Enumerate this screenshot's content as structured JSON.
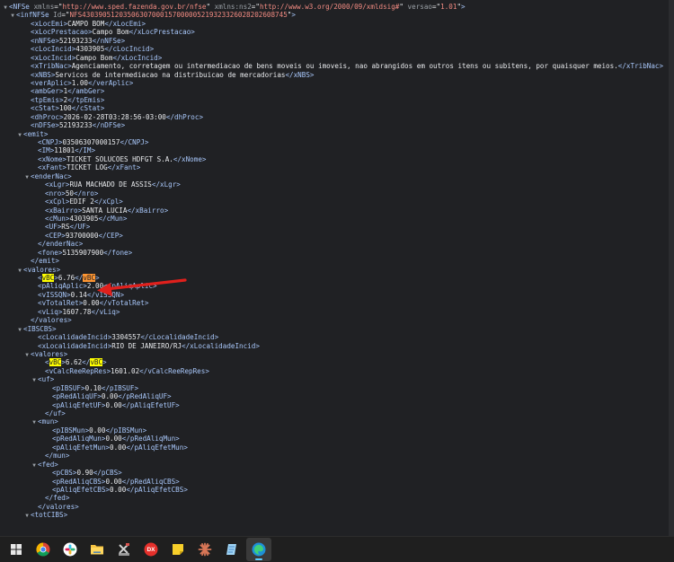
{
  "colors": {
    "tag": "#a8c7fa",
    "attr_name": "#9aa0a6",
    "attr_value": "#f28b82",
    "text": "#e8eaed",
    "highlight": "#ffff00",
    "highlight_current": "#ff9632",
    "annotation_arrow": "#e0201c"
  },
  "xml_lines": [
    {
      "indent": 0,
      "arrow": "down",
      "parts": [
        {
          "c": "tg",
          "t": "<NFSe "
        },
        {
          "c": "an",
          "t": "xmlns"
        },
        {
          "c": "tx",
          "t": "=\""
        },
        {
          "c": "av",
          "t": "http://www.sped.fazenda.gov.br/nfse"
        },
        {
          "c": "tx",
          "t": "\" "
        },
        {
          "c": "an",
          "t": "xmlns:ns2"
        },
        {
          "c": "tx",
          "t": "=\""
        },
        {
          "c": "av",
          "t": "http://www.w3.org/2000/09/xmldsig#"
        },
        {
          "c": "tx",
          "t": "\" "
        },
        {
          "c": "an",
          "t": "versao"
        },
        {
          "c": "tx",
          "t": "=\""
        },
        {
          "c": "av",
          "t": "1.01"
        },
        {
          "c": "tx",
          "t": "\""
        },
        {
          "c": "tg",
          "t": ">"
        }
      ]
    },
    {
      "indent": 1,
      "arrow": "down",
      "parts": [
        {
          "c": "tg",
          "t": "<infNFSe "
        },
        {
          "c": "an",
          "t": "Id"
        },
        {
          "c": "tx",
          "t": "=\""
        },
        {
          "c": "av",
          "t": "NFS43039051203506307000157000005219323326028202608745"
        },
        {
          "c": "tx",
          "t": "\""
        },
        {
          "c": "tg",
          "t": ">"
        }
      ]
    },
    {
      "indent": 3,
      "parts": [
        {
          "c": "tg",
          "t": "<xLocEmi>"
        },
        {
          "c": "tx",
          "t": "CAMPO BOM"
        },
        {
          "c": "tg",
          "t": "</xLocEmi>"
        }
      ]
    },
    {
      "indent": 3,
      "parts": [
        {
          "c": "tg",
          "t": "<xLocPrestacao>"
        },
        {
          "c": "tx",
          "t": "Campo Bom"
        },
        {
          "c": "tg",
          "t": "</xLocPrestacao>"
        }
      ]
    },
    {
      "indent": 3,
      "parts": [
        {
          "c": "tg",
          "t": "<nNFSe>"
        },
        {
          "c": "tx",
          "t": "52193233"
        },
        {
          "c": "tg",
          "t": "</nNFSe>"
        }
      ]
    },
    {
      "indent": 3,
      "parts": [
        {
          "c": "tg",
          "t": "<cLocIncid>"
        },
        {
          "c": "tx",
          "t": "4303905"
        },
        {
          "c": "tg",
          "t": "</cLocIncid>"
        }
      ]
    },
    {
      "indent": 3,
      "parts": [
        {
          "c": "tg",
          "t": "<xLocIncid>"
        },
        {
          "c": "tx",
          "t": "Campo Bom"
        },
        {
          "c": "tg",
          "t": "</xLocIncid>"
        }
      ]
    },
    {
      "indent": 3,
      "parts": [
        {
          "c": "tg",
          "t": "<xTribNac>"
        },
        {
          "c": "tx",
          "t": "Agenciamento, corretagem ou intermediacao de bens moveis ou imoveis, nao abrangidos em outros itens ou subitens, por quaisquer meios."
        },
        {
          "c": "tg",
          "t": "</xTribNac>"
        }
      ]
    },
    {
      "indent": 3,
      "parts": [
        {
          "c": "tg",
          "t": "<xNBS>"
        },
        {
          "c": "tx",
          "t": "Servicos de intermediacao na distribuicao de mercadorias"
        },
        {
          "c": "tg",
          "t": "</xNBS>"
        }
      ]
    },
    {
      "indent": 3,
      "parts": [
        {
          "c": "tg",
          "t": "<verAplic>"
        },
        {
          "c": "tx",
          "t": "1.00"
        },
        {
          "c": "tg",
          "t": "</verAplic>"
        }
      ]
    },
    {
      "indent": 3,
      "parts": [
        {
          "c": "tg",
          "t": "<ambGer>"
        },
        {
          "c": "tx",
          "t": "1"
        },
        {
          "c": "tg",
          "t": "</ambGer>"
        }
      ]
    },
    {
      "indent": 3,
      "parts": [
        {
          "c": "tg",
          "t": "<tpEmis>"
        },
        {
          "c": "tx",
          "t": "2"
        },
        {
          "c": "tg",
          "t": "</tpEmis>"
        }
      ]
    },
    {
      "indent": 3,
      "parts": [
        {
          "c": "tg",
          "t": "<cStat>"
        },
        {
          "c": "tx",
          "t": "100"
        },
        {
          "c": "tg",
          "t": "</cStat>"
        }
      ]
    },
    {
      "indent": 3,
      "parts": [
        {
          "c": "tg",
          "t": "<dhProc>"
        },
        {
          "c": "tx",
          "t": "2026-02-28T03:28:56-03:00"
        },
        {
          "c": "tg",
          "t": "</dhProc>"
        }
      ]
    },
    {
      "indent": 3,
      "parts": [
        {
          "c": "tg",
          "t": "<nDFSe>"
        },
        {
          "c": "tx",
          "t": "52193233"
        },
        {
          "c": "tg",
          "t": "</nDFSe>"
        }
      ]
    },
    {
      "indent": 2,
      "arrow": "down",
      "parts": [
        {
          "c": "tg",
          "t": "<emit>"
        }
      ]
    },
    {
      "indent": 4,
      "parts": [
        {
          "c": "tg",
          "t": "<CNPJ>"
        },
        {
          "c": "tx",
          "t": "03506307000157"
        },
        {
          "c": "tg",
          "t": "</CNPJ>"
        }
      ]
    },
    {
      "indent": 4,
      "parts": [
        {
          "c": "tg",
          "t": "<IM>"
        },
        {
          "c": "tx",
          "t": "11801"
        },
        {
          "c": "tg",
          "t": "</IM>"
        }
      ]
    },
    {
      "indent": 4,
      "parts": [
        {
          "c": "tg",
          "t": "<xNome>"
        },
        {
          "c": "tx",
          "t": "TICKET SOLUCOES HDFGT S.A."
        },
        {
          "c": "tg",
          "t": "</xNome>"
        }
      ]
    },
    {
      "indent": 4,
      "parts": [
        {
          "c": "tg",
          "t": "<xFant>"
        },
        {
          "c": "tx",
          "t": "TICKET LOG"
        },
        {
          "c": "tg",
          "t": "</xFant>"
        }
      ]
    },
    {
      "indent": 3,
      "arrow": "down",
      "parts": [
        {
          "c": "tg",
          "t": "<enderNac>"
        }
      ]
    },
    {
      "indent": 5,
      "parts": [
        {
          "c": "tg",
          "t": "<xLgr>"
        },
        {
          "c": "tx",
          "t": "RUA MACHADO DE ASSIS"
        },
        {
          "c": "tg",
          "t": "</xLgr>"
        }
      ]
    },
    {
      "indent": 5,
      "parts": [
        {
          "c": "tg",
          "t": "<nro>"
        },
        {
          "c": "tx",
          "t": "50"
        },
        {
          "c": "tg",
          "t": "</nro>"
        }
      ]
    },
    {
      "indent": 5,
      "parts": [
        {
          "c": "tg",
          "t": "<xCpl>"
        },
        {
          "c": "tx",
          "t": "EDIF 2"
        },
        {
          "c": "tg",
          "t": "</xCpl>"
        }
      ]
    },
    {
      "indent": 5,
      "parts": [
        {
          "c": "tg",
          "t": "<xBairro>"
        },
        {
          "c": "tx",
          "t": "SANTA LUCIA"
        },
        {
          "c": "tg",
          "t": "</xBairro>"
        }
      ]
    },
    {
      "indent": 5,
      "parts": [
        {
          "c": "tg",
          "t": "<cMun>"
        },
        {
          "c": "tx",
          "t": "4303905"
        },
        {
          "c": "tg",
          "t": "</cMun>"
        }
      ]
    },
    {
      "indent": 5,
      "parts": [
        {
          "c": "tg",
          "t": "<UF>"
        },
        {
          "c": "tx",
          "t": "RS"
        },
        {
          "c": "tg",
          "t": "</UF>"
        }
      ]
    },
    {
      "indent": 5,
      "parts": [
        {
          "c": "tg",
          "t": "<CEP>"
        },
        {
          "c": "tx",
          "t": "93700000"
        },
        {
          "c": "tg",
          "t": "</CEP>"
        }
      ]
    },
    {
      "indent": 4,
      "parts": [
        {
          "c": "tg",
          "t": "</enderNac>"
        }
      ]
    },
    {
      "indent": 4,
      "parts": [
        {
          "c": "tg",
          "t": "<fone>"
        },
        {
          "c": "tx",
          "t": "5135907900"
        },
        {
          "c": "tg",
          "t": "</fone>"
        }
      ]
    },
    {
      "indent": 3,
      "parts": [
        {
          "c": "tg",
          "t": "</emit>"
        }
      ]
    },
    {
      "indent": 2,
      "arrow": "down",
      "parts": [
        {
          "c": "tg",
          "t": "<valores>"
        }
      ]
    },
    {
      "indent": 4,
      "annotated": true,
      "parts": [
        {
          "c": "tg",
          "t": "<"
        },
        {
          "c": "hl",
          "t": "vBC"
        },
        {
          "c": "tg",
          "t": ">"
        },
        {
          "c": "tx",
          "t": "6.76"
        },
        {
          "c": "tg",
          "t": "</"
        },
        {
          "c": "hl-cur",
          "t": "vBC"
        },
        {
          "c": "tg",
          "t": ">"
        }
      ]
    },
    {
      "indent": 4,
      "parts": [
        {
          "c": "tg",
          "t": "<pAliqAplic>"
        },
        {
          "c": "tx",
          "t": "2.00"
        },
        {
          "c": "tg",
          "t": "</pAliqAplic>"
        }
      ]
    },
    {
      "indent": 4,
      "parts": [
        {
          "c": "tg",
          "t": "<vISSQN>"
        },
        {
          "c": "tx",
          "t": "0.14"
        },
        {
          "c": "tg",
          "t": "</vISSQN>"
        }
      ]
    },
    {
      "indent": 4,
      "parts": [
        {
          "c": "tg",
          "t": "<vTotalRet>"
        },
        {
          "c": "tx",
          "t": "0.00"
        },
        {
          "c": "tg",
          "t": "</vTotalRet>"
        }
      ]
    },
    {
      "indent": 4,
      "parts": [
        {
          "c": "tg",
          "t": "<vLiq>"
        },
        {
          "c": "tx",
          "t": "1607.78"
        },
        {
          "c": "tg",
          "t": "</vLiq>"
        }
      ]
    },
    {
      "indent": 3,
      "parts": [
        {
          "c": "tg",
          "t": "</valores>"
        }
      ]
    },
    {
      "indent": 2,
      "arrow": "down",
      "parts": [
        {
          "c": "tg",
          "t": "<IBSCBS>"
        }
      ]
    },
    {
      "indent": 4,
      "parts": [
        {
          "c": "tg",
          "t": "<cLocalidadeIncid>"
        },
        {
          "c": "tx",
          "t": "3304557"
        },
        {
          "c": "tg",
          "t": "</cLocalidadeIncid>"
        }
      ]
    },
    {
      "indent": 4,
      "parts": [
        {
          "c": "tg",
          "t": "<xLocalidadeIncid>"
        },
        {
          "c": "tx",
          "t": "RIO DE JANEIRO/RJ"
        },
        {
          "c": "tg",
          "t": "</xLocalidadeIncid>"
        }
      ]
    },
    {
      "indent": 3,
      "arrow": "down",
      "parts": [
        {
          "c": "tg",
          "t": "<valores>"
        }
      ]
    },
    {
      "indent": 5,
      "parts": [
        {
          "c": "tg",
          "t": "<"
        },
        {
          "c": "hl",
          "t": "vBC"
        },
        {
          "c": "tg",
          "t": ">"
        },
        {
          "c": "tx",
          "t": "6.62"
        },
        {
          "c": "tg",
          "t": "</"
        },
        {
          "c": "hl",
          "t": "vBC"
        },
        {
          "c": "tg",
          "t": ">"
        }
      ]
    },
    {
      "indent": 5,
      "parts": [
        {
          "c": "tg",
          "t": "<vCalcReeRepRes>"
        },
        {
          "c": "tx",
          "t": "1601.02"
        },
        {
          "c": "tg",
          "t": "</vCalcReeRepRes>"
        }
      ]
    },
    {
      "indent": 4,
      "arrow": "down",
      "parts": [
        {
          "c": "tg",
          "t": "<uf>"
        }
      ]
    },
    {
      "indent": 6,
      "parts": [
        {
          "c": "tg",
          "t": "<pIBSUF>"
        },
        {
          "c": "tx",
          "t": "0.10"
        },
        {
          "c": "tg",
          "t": "</pIBSUF>"
        }
      ]
    },
    {
      "indent": 6,
      "parts": [
        {
          "c": "tg",
          "t": "<pRedAliqUF>"
        },
        {
          "c": "tx",
          "t": "0.00"
        },
        {
          "c": "tg",
          "t": "</pRedAliqUF>"
        }
      ]
    },
    {
      "indent": 6,
      "parts": [
        {
          "c": "tg",
          "t": "<pAliqEfetUF>"
        },
        {
          "c": "tx",
          "t": "0.00"
        },
        {
          "c": "tg",
          "t": "</pAliqEfetUF>"
        }
      ]
    },
    {
      "indent": 5,
      "parts": [
        {
          "c": "tg",
          "t": "</uf>"
        }
      ]
    },
    {
      "indent": 4,
      "arrow": "down",
      "parts": [
        {
          "c": "tg",
          "t": "<mun>"
        }
      ]
    },
    {
      "indent": 6,
      "parts": [
        {
          "c": "tg",
          "t": "<pIBSMun>"
        },
        {
          "c": "tx",
          "t": "0.00"
        },
        {
          "c": "tg",
          "t": "</pIBSMun>"
        }
      ]
    },
    {
      "indent": 6,
      "parts": [
        {
          "c": "tg",
          "t": "<pRedAliqMun>"
        },
        {
          "c": "tx",
          "t": "0.00"
        },
        {
          "c": "tg",
          "t": "</pRedAliqMun>"
        }
      ]
    },
    {
      "indent": 6,
      "parts": [
        {
          "c": "tg",
          "t": "<pAliqEfetMun>"
        },
        {
          "c": "tx",
          "t": "0.00"
        },
        {
          "c": "tg",
          "t": "</pAliqEfetMun>"
        }
      ]
    },
    {
      "indent": 5,
      "parts": [
        {
          "c": "tg",
          "t": "</mun>"
        }
      ]
    },
    {
      "indent": 4,
      "arrow": "down",
      "parts": [
        {
          "c": "tg",
          "t": "<fed>"
        }
      ]
    },
    {
      "indent": 6,
      "parts": [
        {
          "c": "tg",
          "t": "<pCBS>"
        },
        {
          "c": "tx",
          "t": "0.90"
        },
        {
          "c": "tg",
          "t": "</pCBS>"
        }
      ]
    },
    {
      "indent": 6,
      "parts": [
        {
          "c": "tg",
          "t": "<pRedAliqCBS>"
        },
        {
          "c": "tx",
          "t": "0.00"
        },
        {
          "c": "tg",
          "t": "</pRedAliqCBS>"
        }
      ]
    },
    {
      "indent": 6,
      "parts": [
        {
          "c": "tg",
          "t": "<pAliqEfetCBS>"
        },
        {
          "c": "tx",
          "t": "0.00"
        },
        {
          "c": "tg",
          "t": "</pAliqEfetCBS>"
        }
      ]
    },
    {
      "indent": 5,
      "parts": [
        {
          "c": "tg",
          "t": "</fed>"
        }
      ]
    },
    {
      "indent": 4,
      "parts": [
        {
          "c": "tg",
          "t": "</valores>"
        }
      ]
    },
    {
      "indent": 3,
      "arrow": "down",
      "parts": [
        {
          "c": "tg",
          "t": "<totCIBS>"
        }
      ]
    }
  ],
  "taskbar": {
    "items": [
      {
        "name": "start-button",
        "icon": "windows-logo-icon",
        "active": false
      },
      {
        "name": "chrome-taskbar-button",
        "icon": "chrome-icon",
        "active": false
      },
      {
        "name": "slack-taskbar-button",
        "icon": "slack-icon",
        "active": false
      },
      {
        "name": "file-explorer-taskbar-button",
        "icon": "folder-icon",
        "active": false
      },
      {
        "name": "tools-taskbar-button",
        "icon": "tools-icon",
        "active": false
      },
      {
        "name": "dx-app-taskbar-button",
        "icon": "dx-icon",
        "label": "DX",
        "active": false
      },
      {
        "name": "sticky-notes-taskbar-button",
        "icon": "sticky-note-icon",
        "active": false
      },
      {
        "name": "claude-taskbar-button",
        "icon": "claude-icon",
        "active": false
      },
      {
        "name": "notepad-taskbar-button",
        "icon": "notepad-icon",
        "active": false
      },
      {
        "name": "edge-taskbar-button",
        "icon": "edge-icon",
        "active": true
      }
    ]
  }
}
